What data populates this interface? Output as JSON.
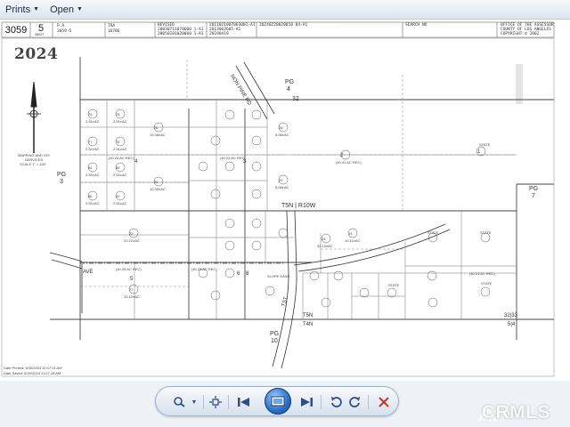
{
  "menu": {
    "items": [
      {
        "label": "Prints",
        "has_menu": true
      },
      {
        "label": "Open",
        "has_menu": true
      }
    ]
  },
  "map_header": {
    "book": "3059",
    "page": "5",
    "sheet_label": "SHEET",
    "pa_label": "P.A.",
    "pa_value": "3059-5",
    "tra_label": "TRA",
    "tra_value": "16786",
    "revised_label": "REVISED",
    "revised_values": [
      "20030711070600 1-A1",
      "20050101020060 1-A1"
    ],
    "revised_values_2": [
      "2011021007063001-A1",
      "2013062605-A1",
      "20190419"
    ],
    "revised_values_3": [
      "20240228020010 04-A1"
    ],
    "search_label": "SEARCH NO",
    "office": [
      "OFFICE OF THE ASSESSOR",
      "COUNTY OF LOS ANGELES",
      "COPYRIGHT © 2002"
    ]
  },
  "map": {
    "year": "2024",
    "north_legend": [
      "MAPPING AND GIS",
      "SERVICES",
      "SCALE 1\" = 400'"
    ],
    "streets": {
      "nonpine": "NON PINE RD",
      "tst": "TST",
      "ave": "AVE",
      "slope": "SLOPE EASE"
    },
    "township": {
      "t5n_r10w": "T5N | R10W",
      "t5n": "T5N",
      "t4n": "T4N"
    },
    "pg_labels": {
      "pg4": [
        "PG",
        "4"
      ],
      "pg3": [
        "PG",
        "3"
      ],
      "pg7": [
        "PG",
        "7"
      ],
      "pg10": [
        "PG",
        "10"
      ]
    },
    "section_numbers": {
      "s32_top": "32",
      "s5_left": "5",
      "s4_mid": "4",
      "s3_mid": "3",
      "s2": "2",
      "s1": "1",
      "s6": "6",
      "s8": "8",
      "s3233": "32|33",
      "s54": "5|4"
    },
    "parcels": [
      {
        "num": "75",
        "acres": "2.51±AC"
      },
      {
        "num": "76",
        "acres": "2.51±AC"
      },
      {
        "num": "77",
        "acres": "2.51±AC"
      },
      {
        "num": "78",
        "acres": "2.51±AC"
      },
      {
        "num": "84",
        "acres": "2.51±AC"
      },
      {
        "num": "85",
        "acres": "2.51±AC"
      },
      {
        "num": "86",
        "acres": "2.51±AC"
      },
      {
        "num": "42",
        "acres": "2.51±AC"
      },
      {
        "num": "26",
        "acres": "10.38±AC"
      },
      {
        "num": "30",
        "acres": "10.35±AC"
      },
      {
        "num": "81",
        "acres": "2.51±AC"
      },
      {
        "num": "79",
        "acres": "2.51±AC"
      },
      {
        "num": "82",
        "acres": "7.16±AC"
      },
      {
        "num": "48",
        "acres": "2.51±AC"
      },
      {
        "num": "43",
        "acres": "2.51±AC"
      },
      {
        "num": "47",
        "acres": "2.51±AC"
      },
      {
        "num": "46",
        "acres": "2.51±AC"
      },
      {
        "num": "83",
        "acres": "7.16±AC"
      },
      {
        "num": "45",
        "acres": "2.51±AC"
      },
      {
        "num": "28",
        "acres": "5.08±AC"
      },
      {
        "num": "29",
        "acres": "5.08±AC"
      },
      {
        "num": "22",
        "acres": "20.12±AC"
      },
      {
        "num": "27",
        "acres": "20.12±AC"
      },
      {
        "num": "71",
        "acres": "2.51±AC"
      },
      {
        "num": "70",
        "acres": "2.51±AC"
      },
      {
        "num": "72",
        "acres": "2.51±AC"
      },
      {
        "num": "73",
        "acres": "3.47±AC"
      },
      {
        "num": "61",
        "acres": "2.51±AC"
      },
      {
        "num": "60",
        "acres": "2.51±AC"
      },
      {
        "num": "62",
        "acres": "2.51±AC"
      },
      {
        "num": "63",
        "acres": "10.35±AC"
      },
      {
        "num": "37",
        "acres": "8.95±AC"
      },
      {
        "num": "78",
        "acres": "2.51±AC"
      },
      {
        "num": "79",
        "acres": "2.51±AC"
      },
      {
        "num": "68",
        "acres": "5.08±AC"
      },
      {
        "num": "67",
        "acres": "5.08±AC"
      },
      {
        "num": "65",
        "acres": "5.08±AC"
      },
      {
        "num": "24",
        "acres": "32.15±AC"
      },
      {
        "num": "13",
        "acres": "10.11±AC"
      },
      {
        "num": "17",
        "acres": "5.07±AC"
      },
      {
        "num": "801",
        "acres": "STATE"
      },
      {
        "num": "802",
        "acres": "STATE"
      },
      {
        "num": "803",
        "acres": "STATE"
      },
      {
        "num": "804",
        "acres": "STATE"
      },
      {
        "num": "900",
        "acres": "STATE"
      }
    ],
    "rec_notes": [
      "(40.24 AC REC)",
      "(40.23 AC REC)",
      "(40.41 AC REC)",
      "(40.25 AC REC)",
      "(40.23 AC REC)",
      "(40.23 AC REC)"
    ],
    "date_printed": "Date Printed: 5/30/2024 11:07:01 AM",
    "date_saved": "Date Saved: 5/29/2024 11:07:28 AM"
  },
  "toolbar": {
    "buttons": [
      "zoom",
      "fit",
      "previous",
      "slideshow",
      "next",
      "rotate-ccw",
      "rotate-cw",
      "delete"
    ]
  },
  "watermark": "CRMLS",
  "colors": {
    "toolbar_accent": "#2a6ec6",
    "delete_red": "#c0392b",
    "line": "#555555"
  }
}
